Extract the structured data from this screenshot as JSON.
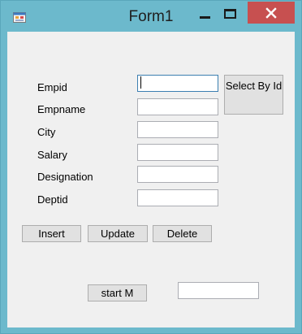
{
  "window": {
    "title": "Form1",
    "icon": "winforms-app-icon",
    "controls": {
      "minimize_icon": "minimize-icon",
      "maximize_icon": "maximize-icon",
      "close_icon": "close-icon"
    },
    "colors": {
      "titlebar": "#6cb9cc",
      "close_button": "#c75050",
      "client_background": "#f0f0f0"
    }
  },
  "form": {
    "fields": [
      {
        "label": "Empid",
        "value": ""
      },
      {
        "label": "Empname",
        "value": ""
      },
      {
        "label": "City",
        "value": ""
      },
      {
        "label": "Salary",
        "value": ""
      },
      {
        "label": "Designation",
        "value": ""
      },
      {
        "label": "Deptid",
        "value": ""
      }
    ],
    "select_button_label": "Select By Id",
    "insert_label": "Insert",
    "update_label": "Update",
    "delete_label": "Delete",
    "start_button_label": "start M",
    "start_output_value": ""
  }
}
